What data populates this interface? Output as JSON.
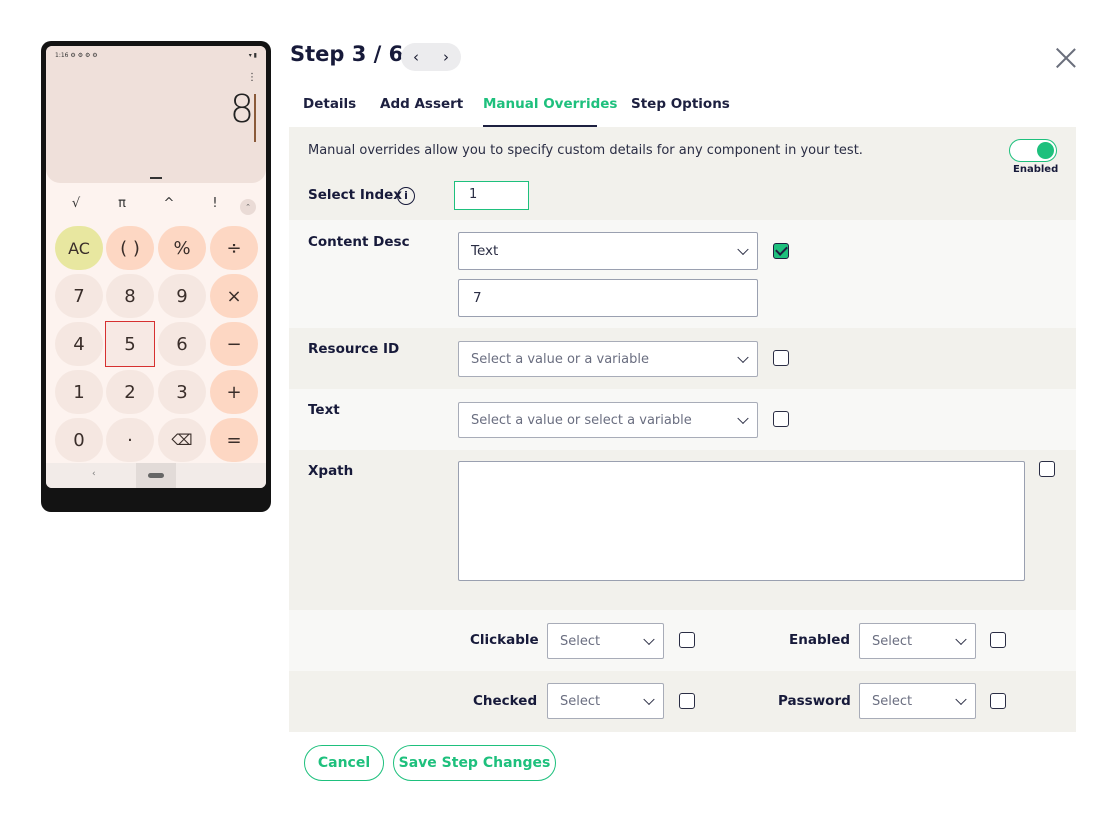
{
  "phone": {
    "status_time": "1:16",
    "status_icons": "⚙ ⚙ ⚙ ⚙",
    "status_right": "▾ ▮",
    "menu_icon": "⋮",
    "display_value": "8",
    "scientific_keys": [
      "√",
      "π",
      "^",
      "!"
    ],
    "expand_icon": "⌃",
    "keys": [
      [
        "AC",
        "( )",
        "%",
        "÷"
      ],
      [
        "7",
        "8",
        "9",
        "×"
      ],
      [
        "4",
        "5",
        "6",
        "−"
      ],
      [
        "1",
        "2",
        "3",
        "+"
      ],
      [
        "0",
        "·",
        "⌫",
        "="
      ]
    ],
    "nav_back": "‹"
  },
  "header": {
    "title": "Step 3 / 6",
    "prev_icon": "‹",
    "next_icon": "›"
  },
  "tabs": [
    "Details",
    "Add Assert",
    "Manual Overrides",
    "Step Options"
  ],
  "active_tab": "Manual Overrides",
  "overrides": {
    "description": "Manual overrides allow you to specify custom details for any component in your test.",
    "toggle_label": "Enabled",
    "toggle_on": true,
    "select_index": {
      "label": "Select Index",
      "info_icon": "i",
      "value": "1"
    },
    "content_desc": {
      "label": "Content Desc",
      "type": "Text",
      "value": "7",
      "checked": true
    },
    "resource_id": {
      "label": "Resource ID",
      "placeholder": "Select a value or a variable",
      "checked": false
    },
    "text": {
      "label": "Text",
      "placeholder": "Select a value or select a variable",
      "checked": false
    },
    "xpath": {
      "label": "Xpath",
      "value": "",
      "checked": false
    },
    "clickable": {
      "label": "Clickable",
      "placeholder": "Select",
      "checked": false
    },
    "enabled": {
      "label": "Enabled",
      "placeholder": "Select",
      "checked": false
    },
    "checked": {
      "label": "Checked",
      "placeholder": "Select",
      "checked": false
    },
    "password": {
      "label": "Password",
      "placeholder": "Select",
      "checked": false
    }
  },
  "buttons": {
    "cancel": "Cancel",
    "save": "Save Step Changes"
  },
  "colors": {
    "accent": "#1ec07d",
    "navy": "#171a3a",
    "row_shade": "#f2f1ec"
  }
}
